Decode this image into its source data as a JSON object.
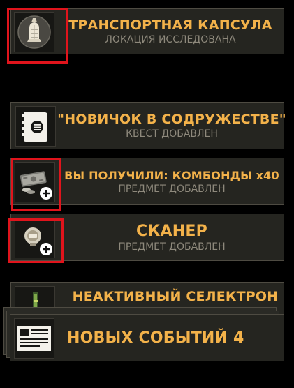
{
  "notifications": [
    {
      "title": "ТРАНСПОРТНАЯ КАПСУЛА",
      "subtitle": "ЛОКАЦИЯ ИССЛЕДОВАНА",
      "icon": "capsule-icon"
    },
    {
      "title": "\"НОВИЧОК В СОДРУЖЕСТВЕ\"",
      "subtitle": "КВЕСТ ДОБАВЛЕН",
      "icon": "quest-book-icon"
    },
    {
      "title": "ВЫ ПОЛУЧИЛИ: КОМБОНДЫ x40",
      "subtitle": "ПРЕДМЕТ ДОБАВЛЕН",
      "icon": "combonds-icon"
    },
    {
      "title": "СКАНЕР",
      "subtitle": "ПРЕДМЕТ ДОБАВЛЕН",
      "icon": "scanner-icon"
    },
    {
      "title": "НЕАКТИВНЫЙ СЕЛЕКТРОН",
      "subtitle": "",
      "icon": "selectron-icon"
    }
  ],
  "summary": {
    "title": "НОВЫХ СОБЫТИЙ 4",
    "icon": "document-icon"
  },
  "colors": {
    "title": "#f3b24a",
    "subtitle": "#8e897c",
    "panel": "#252520",
    "highlight": "#e0141c"
  }
}
